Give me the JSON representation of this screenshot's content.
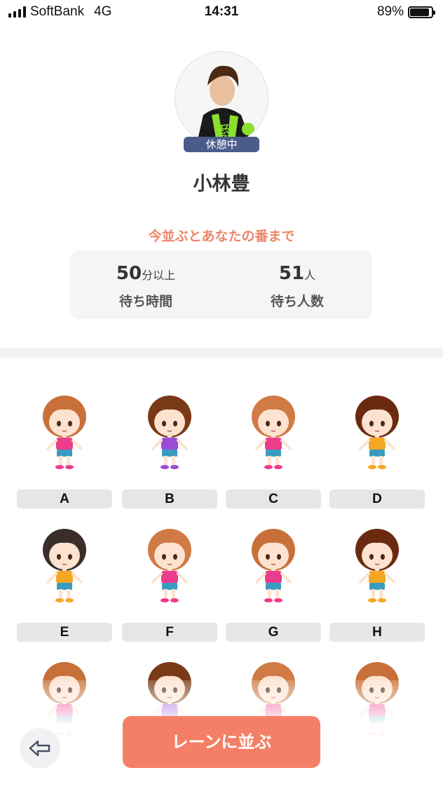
{
  "status_bar": {
    "carrier": "SoftBank",
    "network": "4G",
    "time": "14:31",
    "battery_percent": "89%",
    "battery_level": 0.89
  },
  "profile": {
    "photo_icon": "performer-photo",
    "status_badge": "休憩中",
    "name": "小林豊"
  },
  "queue_info": {
    "heading": "今並ぶとあなたの番まで",
    "wait_time": {
      "value": "50",
      "unit": "分以上",
      "label": "待ち時間"
    },
    "wait_people": {
      "value": "51",
      "unit": "人",
      "label": "待ち人数"
    }
  },
  "avatars": [
    {
      "label": "A",
      "hair": "#c8703a",
      "shirt": "#ec3c8c",
      "shorts": "#3a9bc0"
    },
    {
      "label": "B",
      "hair": "#7a3a16",
      "shirt": "#9a4cd8",
      "shorts": "#3a9bc0"
    },
    {
      "label": "C",
      "hair": "#d07a45",
      "shirt": "#ec3c8c",
      "shorts": "#3a9bc0"
    },
    {
      "label": "D",
      "hair": "#6b2a10",
      "shirt": "#f5a623",
      "shorts": "#3a9bc0"
    },
    {
      "label": "E",
      "hair": "#3a2e2a",
      "shirt": "#f5a623",
      "shorts": "#3a9bc0"
    },
    {
      "label": "F",
      "hair": "#d07a45",
      "shirt": "#ec3c8c",
      "shorts": "#3a9bc0"
    },
    {
      "label": "G",
      "hair": "#c8703a",
      "shirt": "#ec3c8c",
      "shorts": "#3a9bc0"
    },
    {
      "label": "H",
      "hair": "#6b2a10",
      "shirt": "#f5a623",
      "shorts": "#3a9bc0"
    },
    {
      "label": "",
      "hair": "#c8703a",
      "shirt": "#ec3c8c",
      "shorts": "#3a9bc0"
    },
    {
      "label": "",
      "hair": "#7a3a16",
      "shirt": "#9a4cd8",
      "shorts": "#3a9bc0"
    },
    {
      "label": "",
      "hair": "#d07a45",
      "shirt": "#ec3c8c",
      "shorts": "#3a9bc0"
    },
    {
      "label": "",
      "hair": "#c8703a",
      "shirt": "#ec3c8c",
      "shorts": "#3a9bc0"
    }
  ],
  "actions": {
    "back_icon": "arrow-left-icon",
    "queue_button": "レーンに並ぶ"
  },
  "colors": {
    "accent": "#f47f66",
    "heading": "#ef8468",
    "badge": "#4a5c8c"
  }
}
